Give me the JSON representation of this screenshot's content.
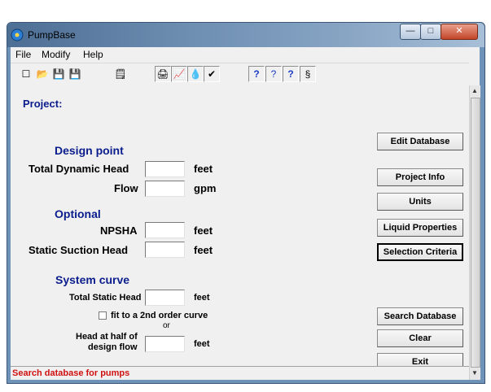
{
  "window": {
    "title": "PumpBase",
    "min_glyph": "—",
    "max_glyph": "□",
    "close_glyph": "✕"
  },
  "menu": [
    "File",
    "Modify",
    "Help"
  ],
  "toolbar": {
    "icons": [
      "new-file-icon",
      "open-folder-icon",
      "save-icon",
      "save-as-icon",
      "edit-form-icon",
      "print-icon",
      "chart-icon",
      "liquid-drop-icon",
      "check-icon",
      "help-icon",
      "context-help-icon",
      "about-icon",
      "info-icon"
    ],
    "glyphs": [
      "☐",
      "📂",
      "💾",
      "💾",
      "🗒",
      "🖨",
      "📈",
      "💧",
      "✔",
      "?",
      "?",
      "?",
      "§"
    ]
  },
  "form": {
    "project_label": "Project:",
    "design_point_header": "Design point",
    "total_dynamic_head_label": "Total Dynamic Head",
    "total_dynamic_head_value": "",
    "total_dynamic_head_unit": "feet",
    "flow_label": "Flow",
    "flow_value": "",
    "flow_unit": "gpm",
    "optional_header": "Optional",
    "npsha_label": "NPSHA",
    "npsha_value": "",
    "npsha_unit": "feet",
    "static_suction_head_label": "Static Suction Head",
    "static_suction_head_value": "",
    "static_suction_head_unit": "feet",
    "system_curve_header": "System curve",
    "total_static_head_label": "Total Static Head",
    "total_static_head_value": "",
    "total_static_head_unit": "feet",
    "fit_curve_label": "fit to a 2nd order curve",
    "fit_curve_checked": false,
    "or_label": "or",
    "head_half_label_1": "Head at half of",
    "head_half_label_2": "design flow",
    "head_half_value": "",
    "head_half_unit": "feet"
  },
  "buttons": {
    "edit_database": "Edit Database",
    "project_info": "Project Info",
    "units": "Units",
    "liquid_properties": "Liquid Properties",
    "selection_criteria": "Selection Criteria",
    "search_database": "Search Database",
    "clear": "Clear",
    "exit": "Exit"
  },
  "status_text": "Search database for pumps"
}
